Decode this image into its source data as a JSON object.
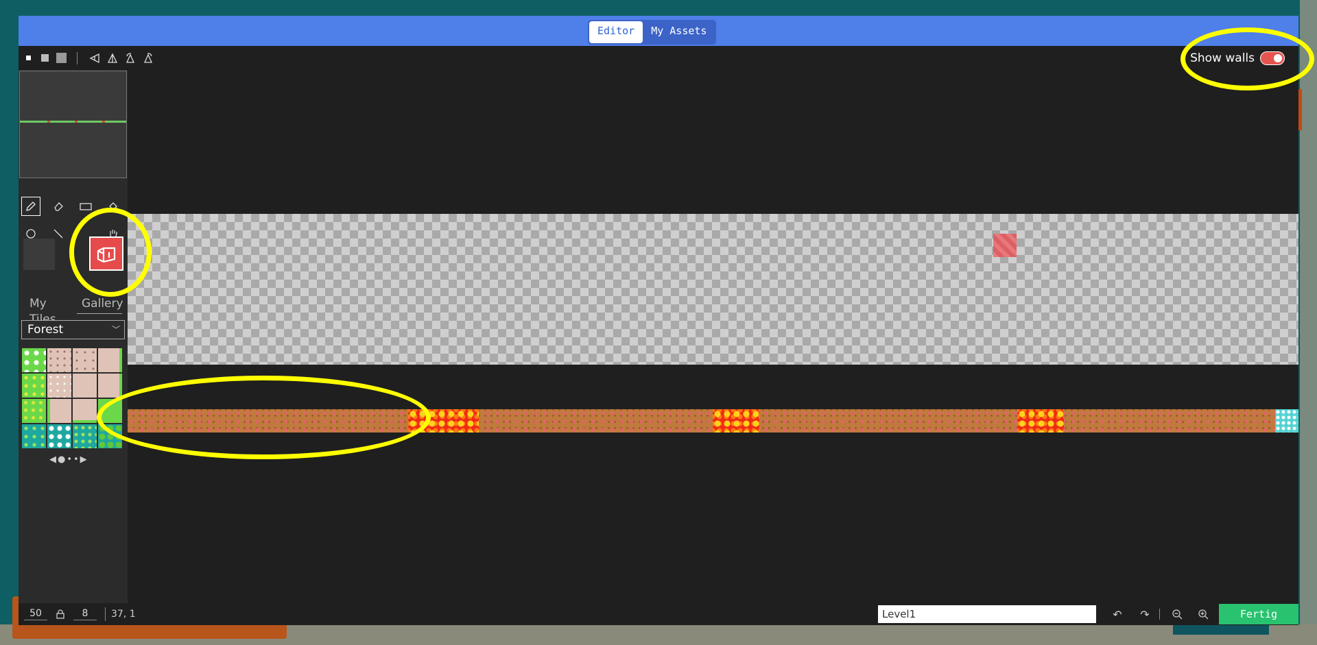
{
  "tabs": [
    {
      "label": "Editor",
      "active": true
    },
    {
      "label": "My Assets",
      "active": false
    }
  ],
  "toolbar": {
    "show_walls_label": "Show walls",
    "show_walls_on": true
  },
  "sidebar": {
    "tab_my_tiles": "My\nTiles",
    "tab_gallery": "Gallery",
    "tileset": "Forest",
    "pager": "◀●••▶"
  },
  "statusbar": {
    "width": "50",
    "height": "8",
    "coords": "37, 1",
    "level_name": "Level1",
    "done_label": "Fertig"
  },
  "colors": {
    "accent": "#4f7fe8",
    "done": "#29c26e",
    "wall_toggle": "#e6544f",
    "highlight": "#ffff00"
  },
  "icons": [
    "pencil-icon",
    "eraser-icon",
    "rectangle-icon",
    "fill-icon",
    "circle-icon",
    "line-icon",
    "hand-icon",
    "undo-icon",
    "redo-icon",
    "zoom-out-icon",
    "zoom-in-icon",
    "lock-icon",
    "wall-icon"
  ]
}
